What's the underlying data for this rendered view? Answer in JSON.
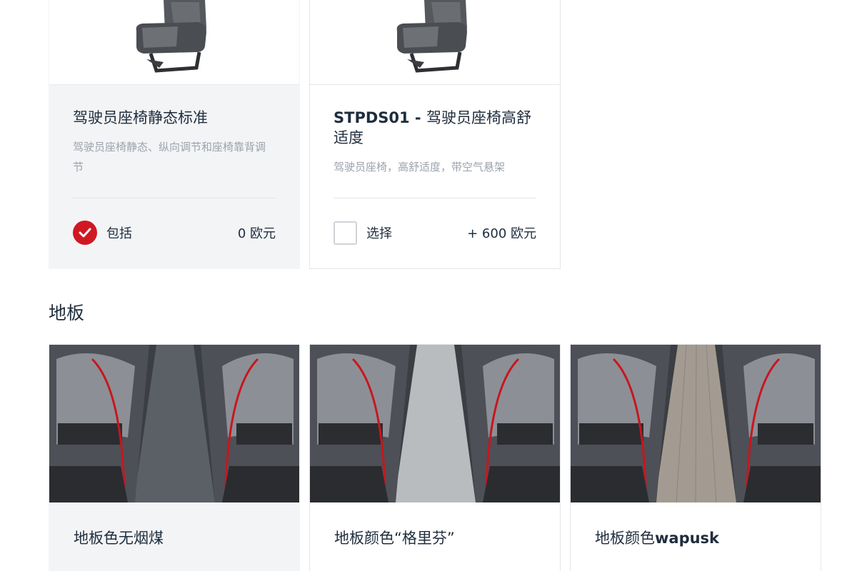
{
  "seats": [
    {
      "title": "驾驶员座椅静态标准",
      "title_prefix": "",
      "description": "驾驶员座椅静态、纵向调节和座椅靠背调节",
      "status_label": "包括",
      "price": "0 欧元",
      "selected": true
    },
    {
      "title": "驾驶员座椅高舒适度",
      "title_prefix": "STPDS01 - ",
      "description": "驾驶员座椅，高舒适度，带空气悬架",
      "status_label": "选择",
      "price": "+ 600 欧元",
      "selected": false
    }
  ],
  "floor_section": {
    "title": "地板",
    "options": [
      {
        "title": "地板色无烟煤",
        "title_latin": "",
        "floor_color": "#5b5f66",
        "selected": true
      },
      {
        "title": "地板颜色“格里芬”",
        "title_latin": "",
        "floor_color": "#b9bcbf",
        "selected": false
      },
      {
        "title": "地板颜色",
        "title_latin": "wapusk",
        "floor_color": "#a39b91",
        "selected": false
      }
    ]
  },
  "colors": {
    "accent": "#d01822",
    "text": "#1f2d3d",
    "muted": "#9ba3ad",
    "card_grey": "#f3f4f6"
  }
}
